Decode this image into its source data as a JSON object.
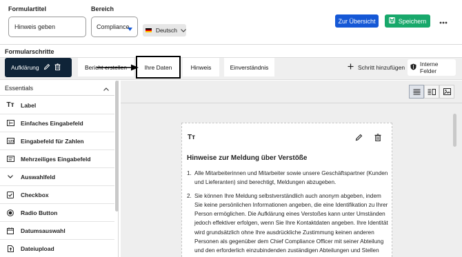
{
  "form": {
    "title_label": "Formulartitel",
    "title_value": "Hinweis geben",
    "area_label": "Bereich",
    "area_value": "Compliance",
    "language_value": "Deutsch"
  },
  "header_actions": {
    "overview_label": "Zur Übersicht",
    "save_label": "Speichern",
    "more_icon": "more-horizontal-icon"
  },
  "steps": {
    "section_label": "Formularschritte",
    "items": [
      {
        "label": "Aufklärung",
        "active": true
      },
      {
        "label": "Bericht erstellen"
      },
      {
        "label": "Ihre Daten",
        "highlighted": true
      },
      {
        "label": "Hinweis"
      },
      {
        "label": "Einverständnis"
      }
    ],
    "add_label": "Schritt hinzufügen",
    "internal_fields_label": "Interne Felder"
  },
  "sidebar": {
    "section_label": "Essentials",
    "items": [
      {
        "label": "Label",
        "icon": "text-type-icon"
      },
      {
        "label": "Einfaches Eingabefeld",
        "icon": "input-field-icon"
      },
      {
        "label": "Eingabefeld für Zahlen",
        "icon": "number-field-icon"
      },
      {
        "label": "Mehrzeiliges Eingabefeld",
        "icon": "textarea-icon"
      },
      {
        "label": "Auswahlfeld",
        "icon": "chevron-down-icon"
      },
      {
        "label": "Checkbox",
        "icon": "checkbox-icon"
      },
      {
        "label": "Radio Button",
        "icon": "radio-button-icon"
      },
      {
        "label": "Datumsauswahl",
        "icon": "calendar-icon"
      },
      {
        "label": "Dateiupload",
        "icon": "file-upload-icon"
      }
    ]
  },
  "card": {
    "type_glyph": "Tт",
    "heading": "Hinweise zur Meldung über Verstöße",
    "items": [
      {
        "num": "1.",
        "text": "Alle Mitarbeiterinnen und Mitarbeiter sowie unsere Geschäftspartner (Kunden und Lieferanten) sind berechtigt, Meldungen abzugeben."
      },
      {
        "num": "2.",
        "text": "Sie können Ihre Meldung selbstverständlich auch anonym abgeben, indem Sie keine persönlichen Informationen angeben, die eine Identifikation zu Ihrer Person ermöglichen. Die Aufklärung eines Verstoßes kann unter Umständen jedoch effektiver erfolgen, wenn Sie Ihre Kontaktdaten angeben. Ihre Identität wird grundsätzlich ohne Ihre ausdrückliche Zustimmung keinen anderen Personen als gegenüber dem Chief Compliance Officer mit seiner Abteilung und den erforderlich einzubindenden zuständigen Abteilungen und Stellen offenbart (Anonymität wird gewahrt, bis die Person eine Meldung abgibt)."
      }
    ]
  },
  "colors": {
    "primary_blue": "#1558d6",
    "save_green": "#18a86b",
    "active_step": "#0f2438"
  }
}
